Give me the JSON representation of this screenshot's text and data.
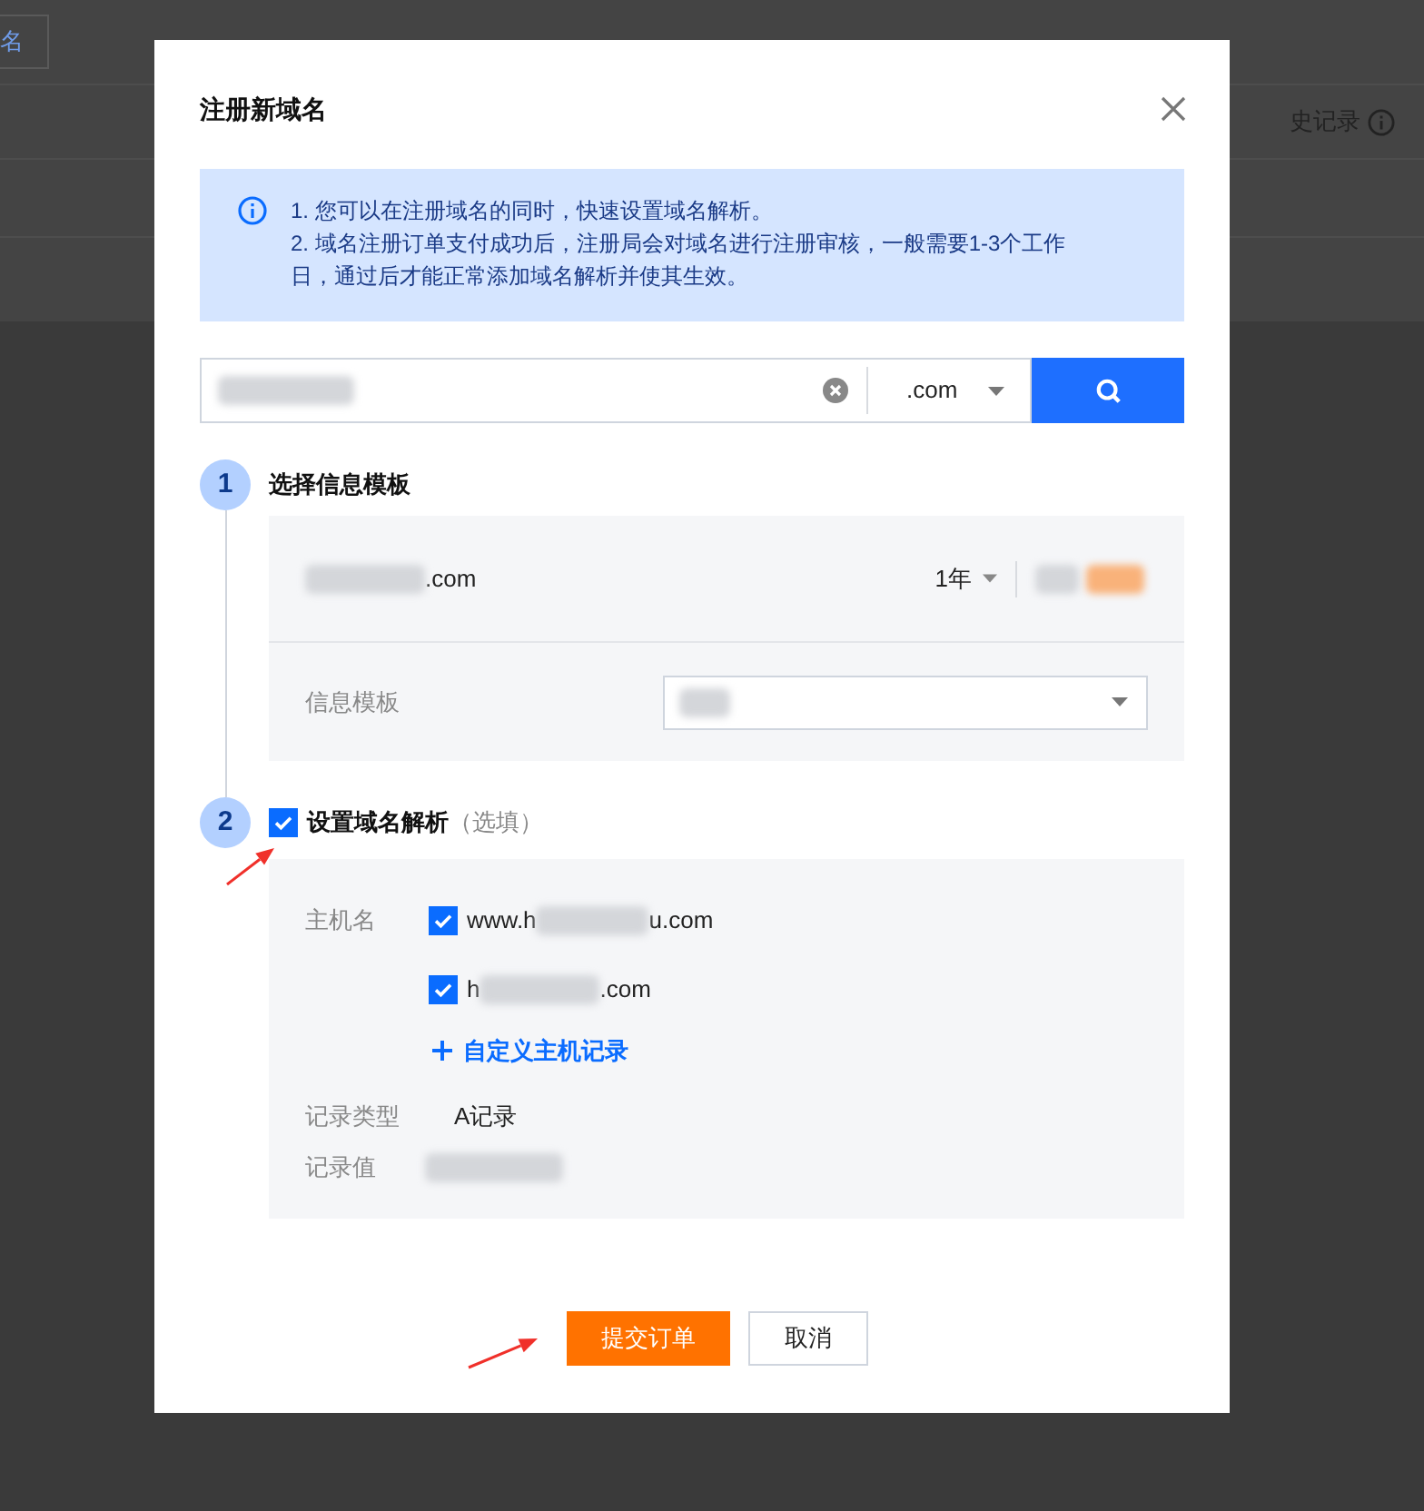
{
  "background": {
    "top_button": "名",
    "history_link": "史记录"
  },
  "dialog": {
    "title": "注册新域名",
    "notice": [
      "1. 您可以在注册域名的同时，快速设置域名解析。",
      "2. 域名注册订单支付成功后，注册局会对域名进行注册审核，一般需要1-3个工作日，通过后才能正常添加域名解析并使其生效。"
    ],
    "search": {
      "value": [
        {
          "kind": "blurred"
        }
      ],
      "suffix": ".com"
    },
    "steps": [
      {
        "number": "1",
        "title": "选择信息模板",
        "domain": [
          {
            "kind": "blurred"
          },
          {
            "kind": "text",
            "text": ".com"
          }
        ],
        "period": "1年",
        "template_label": "信息模板"
      },
      {
        "number": "2",
        "title": "设置域名解析",
        "hint": "（选填）",
        "checked": true,
        "host_label": "主机名",
        "hosts": [
          {
            "checked": true,
            "parts": [
              {
                "kind": "text",
                "text": "www.h"
              },
              {
                "kind": "blurred"
              },
              {
                "kind": "text",
                "text": "u.com"
              }
            ]
          },
          {
            "checked": true,
            "parts": [
              {
                "kind": "text",
                "text": "h"
              },
              {
                "kind": "blurred"
              },
              {
                "kind": "text",
                "text": ".com"
              }
            ]
          }
        ],
        "add_link": "自定义主机记录",
        "record_type_label": "记录类型",
        "record_type": "A记录",
        "record_value_label": "记录值"
      }
    ],
    "buttons": [
      {
        "label": "提交订单",
        "kind": "primary"
      },
      {
        "label": "取消",
        "kind": "secondary"
      }
    ]
  }
}
